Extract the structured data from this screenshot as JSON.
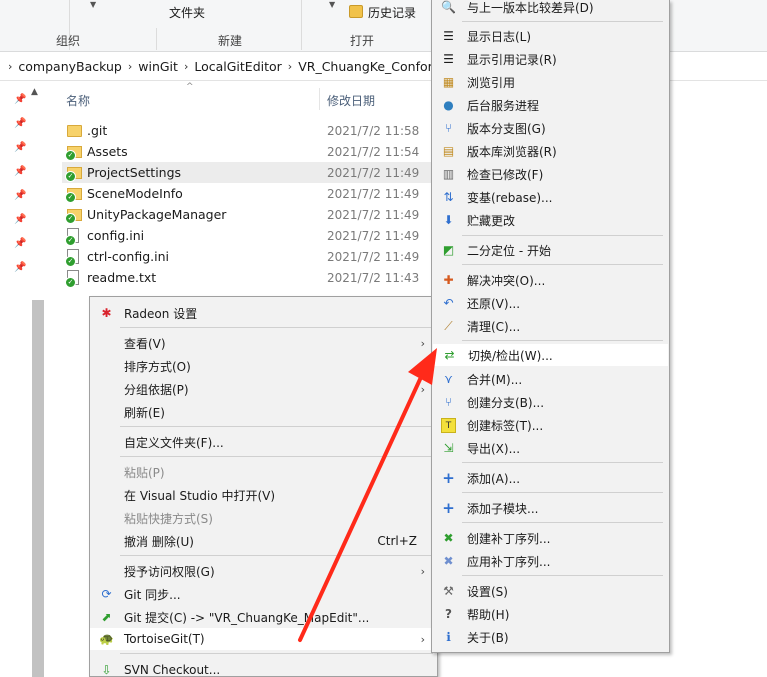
{
  "ribbon": {
    "new_folder": "文件夹",
    "history": "历史记录",
    "groups": {
      "organize": "组织",
      "new": "新建",
      "open": "打开"
    }
  },
  "address": {
    "crumbs": [
      "companyBackup",
      "winGit",
      "LocalGitEditor",
      "VR_ChuangKe_Confor"
    ]
  },
  "columns": {
    "name": "名称",
    "modified": "修改日期"
  },
  "files": [
    {
      "name": ".git",
      "date": "2021/7/2 11:58",
      "icon": "folder-icon"
    },
    {
      "name": "Assets",
      "date": "2021/7/2 11:54",
      "icon": "git-folder-icon"
    },
    {
      "name": "ProjectSettings",
      "date": "2021/7/2 11:49",
      "icon": "git-folder-icon"
    },
    {
      "name": "SceneModeInfo",
      "date": "2021/7/2 11:49",
      "icon": "git-folder-icon"
    },
    {
      "name": "UnityPackageManager",
      "date": "2021/7/2 11:49",
      "icon": "git-folder-icon"
    },
    {
      "name": "config.ini",
      "date": "2021/7/2 11:49",
      "icon": "git-file-icon"
    },
    {
      "name": "ctrl-config.ini",
      "date": "2021/7/2 11:49",
      "icon": "git-file-icon"
    },
    {
      "name": "readme.txt",
      "date": "2021/7/2 11:43",
      "icon": "git-file-icon"
    }
  ],
  "context_menu": {
    "radeon": "Radeon 设置",
    "view": "查看(V)",
    "sort": "排序方式(O)",
    "group": "分组依据(P)",
    "refresh": "刷新(E)",
    "customize": "自定义文件夹(F)...",
    "paste": "粘贴(P)",
    "open_vs": "在 Visual Studio 中打开(V)",
    "paste_shortcut": "粘贴快捷方式(S)",
    "undo_delete": "撤消 删除(U)",
    "undo_shortcut": "Ctrl+Z",
    "grant_access": "授予访问权限(G)",
    "git_sync": "Git 同步...",
    "git_commit": "Git 提交(C) -> \"VR_ChuangKe_MapEdit\"...",
    "tortoisegit": "TortoiseGit(T)",
    "svn_checkout": "SVN Checkout..."
  },
  "submenu": {
    "diff_prev": "与上一版本比较差异(D)",
    "show_log": "显示日志(L)",
    "show_reflog": "显示引用记录(R)",
    "browse_refs": "浏览引用",
    "daemon": "后台服务进程",
    "revision_graph": "版本分支图(G)",
    "repo_browser": "版本库浏览器(R)",
    "check_mods": "检查已修改(F)",
    "rebase": "变基(rebase)...",
    "stash": "贮藏更改",
    "bisect": "二分定位 - 开始",
    "resolve": "解决冲突(O)...",
    "revert": "还原(V)...",
    "cleanup": "清理(C)...",
    "switch": "切换/检出(W)...",
    "merge": "合并(M)...",
    "branch": "创建分支(B)...",
    "tag": "创建标签(T)...",
    "export": "导出(X)...",
    "add": "添加(A)...",
    "submodule": "添加子模块...",
    "create_patch": "创建补丁序列...",
    "apply_patch": "应用补丁序列...",
    "settings": "设置(S)",
    "help": "帮助(H)",
    "about": "关于(B)"
  },
  "colors": {
    "arrow": "#ff2a1a",
    "accent_blue": "#2f6fcf",
    "git_green": "#2f9e2f"
  }
}
